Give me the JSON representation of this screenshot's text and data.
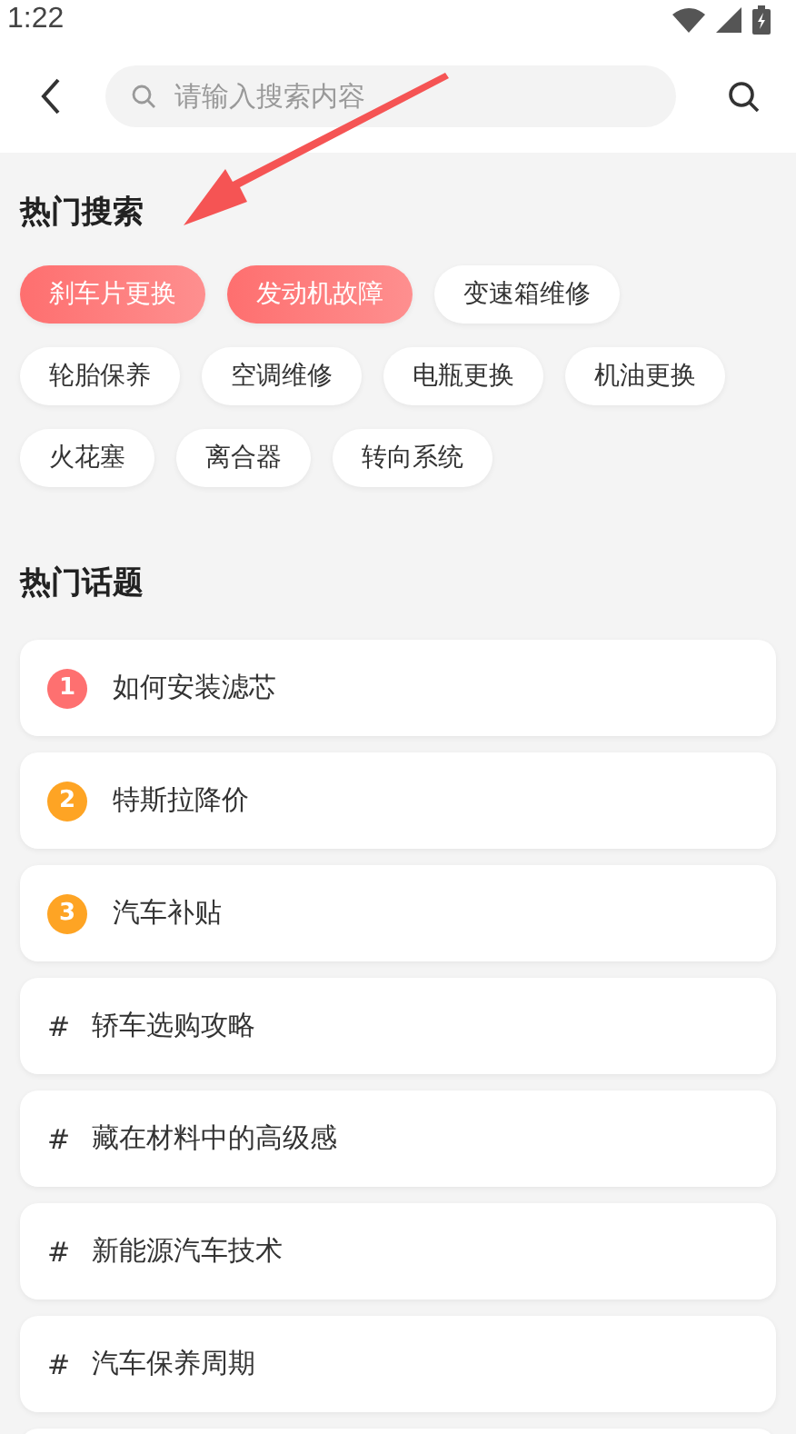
{
  "status_bar": {
    "time": "1:22"
  },
  "search": {
    "placeholder": "请输入搜索内容"
  },
  "hot_searches": {
    "title": "热门搜索",
    "tags": [
      {
        "label": "刹车片更换",
        "hot": true
      },
      {
        "label": "发动机故障",
        "hot": true
      },
      {
        "label": "变速箱维修",
        "hot": false
      },
      {
        "label": "轮胎保养",
        "hot": false
      },
      {
        "label": "空调维修",
        "hot": false
      },
      {
        "label": "电瓶更换",
        "hot": false
      },
      {
        "label": "机油更换",
        "hot": false
      },
      {
        "label": "火花塞",
        "hot": false
      },
      {
        "label": "离合器",
        "hot": false
      },
      {
        "label": "转向系统",
        "hot": false
      }
    ]
  },
  "hot_topics": {
    "title": "热门话题",
    "items": [
      {
        "kind": "ranked",
        "marker": "1",
        "color": "#fe7070",
        "title": "如何安装滤芯"
      },
      {
        "kind": "ranked",
        "marker": "2",
        "color": "#fea424",
        "title": "特斯拉降价"
      },
      {
        "kind": "ranked",
        "marker": "3",
        "color": "#fea424",
        "title": "汽车补贴"
      },
      {
        "kind": "topic",
        "marker": "#",
        "title": "轿车选购攻略"
      },
      {
        "kind": "topic",
        "marker": "#",
        "title": "藏在材料中的高级感"
      },
      {
        "kind": "topic",
        "marker": "#",
        "title": "新能源汽车技术"
      },
      {
        "kind": "topic",
        "marker": "#",
        "title": "汽车保养周期"
      }
    ]
  }
}
